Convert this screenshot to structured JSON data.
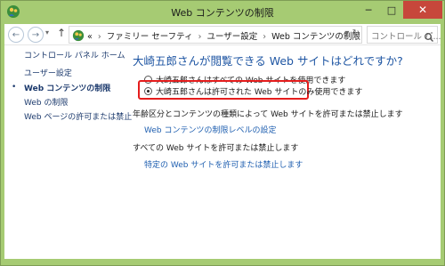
{
  "window": {
    "title": "Web コンテンツの制限",
    "minimize": "─",
    "maximize": "□",
    "close": "✕"
  },
  "nav": {
    "back": "←",
    "forward": "→",
    "dropdown": "▾",
    "up": "↑",
    "breadcrumbs": [
      "ファミリー セーフティ",
      "ユーザー設定",
      "Web コンテンツの制限"
    ],
    "crumb_prefix": "«",
    "crumb_sep": "›",
    "address_dropdown": "▾",
    "refresh": "↻",
    "search_placeholder": "コントロール パ..."
  },
  "sidebar": {
    "home": "コントロール パネル ホーム",
    "items": [
      {
        "label": "ユーザー設定",
        "active": false
      },
      {
        "label": "Web コンテンツの制限",
        "active": true
      },
      {
        "label": "Web の制限",
        "active": false
      },
      {
        "label": "Web ページの許可または禁止",
        "active": false
      }
    ],
    "bullet": "•"
  },
  "main": {
    "heading": "大崎五郎さんが閲覧できる Web サイトはどれですか?",
    "options": [
      {
        "label": "大崎五郎さんはすべての Web サイトを使用できます",
        "selected": false
      },
      {
        "label": "大崎五郎さんは許可された Web サイトのみ使用できます",
        "selected": true
      }
    ],
    "section1": "年齢区分とコンテンツの種類によって Web サイトを許可または禁止します",
    "link1": "Web コンテンツの制限レベルの設定",
    "section2": "すべての Web サイトを許可または禁止します",
    "link2": "特定の Web サイトを許可または禁止します"
  },
  "colors": {
    "window_frame": "#a6cb73",
    "heading": "#1f56a3",
    "link": "#1f5fb0",
    "highlight": "#e51d1d",
    "close_button": "#c7473b"
  }
}
